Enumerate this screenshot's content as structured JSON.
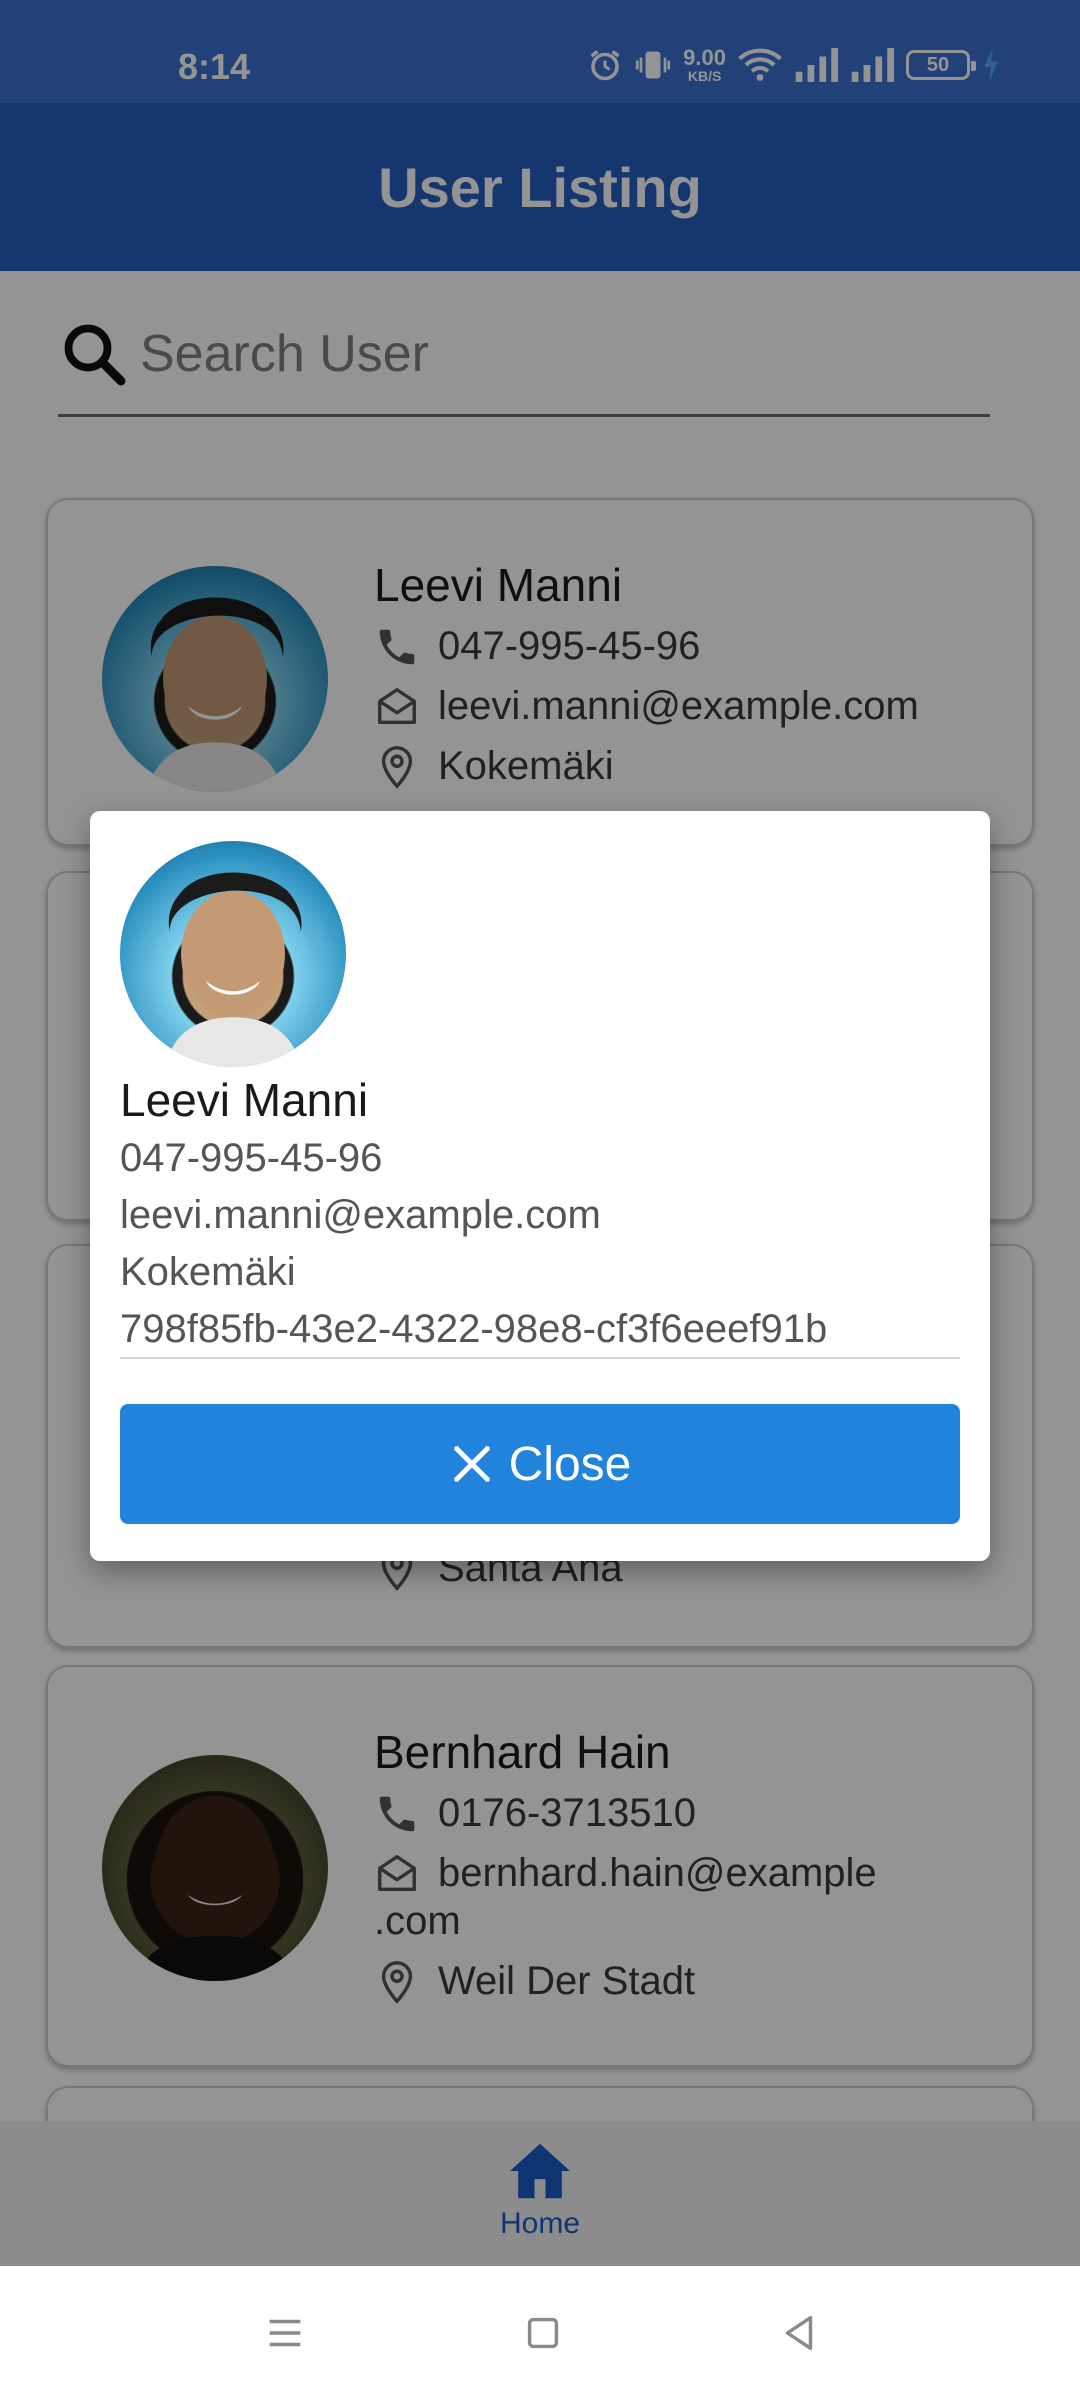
{
  "status_bar": {
    "time": "8:14",
    "net_speed_value": "9.00",
    "net_speed_unit": "KB/S",
    "battery": "50",
    "icons": [
      "alarm-icon",
      "vibrate-icon",
      "wifi-icon",
      "signal-icon",
      "signal-icon",
      "battery-icon",
      "charging-icon"
    ]
  },
  "app_bar": {
    "title": "User Listing"
  },
  "search": {
    "placeholder": "Search User",
    "value": ""
  },
  "users": [
    {
      "name": "Leevi Manni",
      "phone": "047-995-45-96",
      "email": "leevi.manni@example.com",
      "city": "Kokemäki"
    },
    {
      "name": "",
      "phone": "",
      "email": "",
      "city": ""
    },
    {
      "name": "",
      "phone": "",
      "email": "",
      "city": "Santa Ana"
    },
    {
      "name": "Bernhard Hain",
      "phone": "0176-3713510",
      "email_line1": "bernhard.hain@example",
      "email_line2": ".com",
      "city": "Weil Der Stadt"
    }
  ],
  "dialog": {
    "name": "Leevi Manni",
    "phone": "047-995-45-96",
    "email": "leevi.manni@example.com",
    "city": "Kokemäki",
    "id": "798f85fb-43e2-4322-98e8-cf3f6eeef91b",
    "close_label": "Close"
  },
  "bottom_nav": {
    "home_label": "Home"
  },
  "colors": {
    "status_bar": "#3a70cf",
    "app_bar": "#255ec0",
    "accent": "#2183dc",
    "nav_active": "#1b5dc4"
  }
}
